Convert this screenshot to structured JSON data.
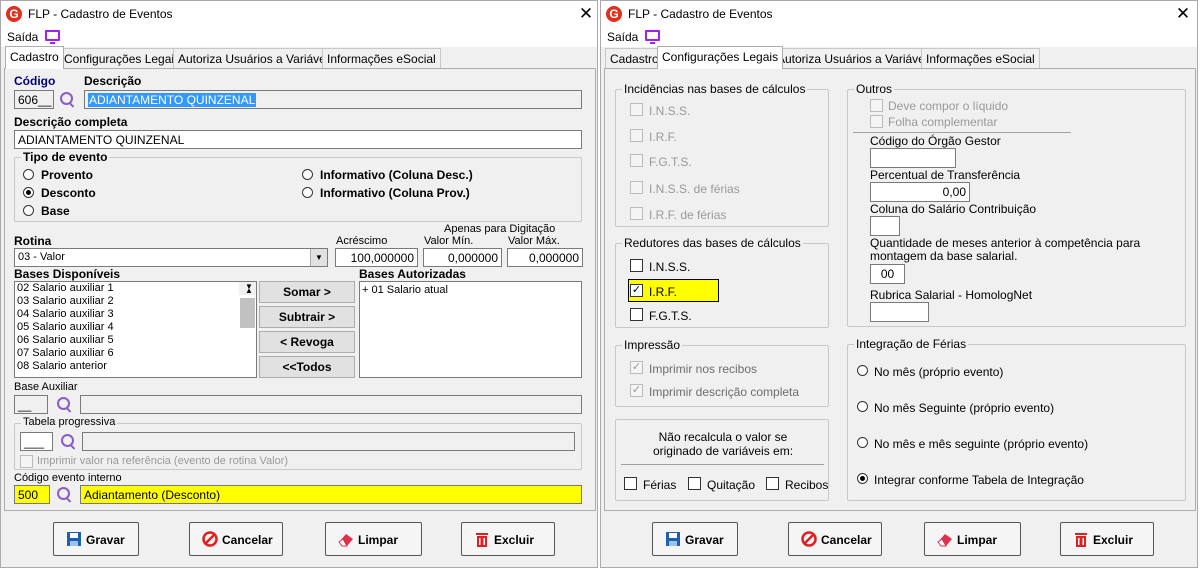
{
  "left": {
    "title": "FLP - Cadastro de Eventos",
    "menu": "Saída",
    "tabs": [
      "Cadastro",
      "Configurações Legais",
      "Autoriza Usuários a Variáveis",
      "Informações eSocial"
    ],
    "codigo_label": "Código",
    "codigo_value": "606__",
    "descricao_label": "Descrição",
    "descricao_value": "ADIANTAMENTO QUINZENAL",
    "desc_completa_label": "Descrição completa",
    "desc_completa_value": "ADIANTAMENTO QUINZENAL",
    "tipo_evento": {
      "title": "Tipo de evento",
      "proventos": "Provento",
      "desconto": "Desconto",
      "base": "Base",
      "info_desc": "Informativo (Coluna Desc.)",
      "info_prov": "Informativo (Coluna Prov.)"
    },
    "rotina_label": "Rotina",
    "rotina_value": "03 - Valor",
    "apenas_label": "Apenas para Digitação",
    "acrescimo_label": "Acréscimo",
    "acrescimo_value": "100,000000",
    "valor_min_label": "Valor Mín.",
    "valor_min_value": "0,000000",
    "valor_max_label": "Valor Máx.",
    "valor_max_value": "0,000000",
    "bases_disp_label": "Bases Disponíveis",
    "bases_disp": [
      "02 Salario auxiliar 1",
      "03 Salario auxiliar 2",
      "04 Salario auxiliar 3",
      "05 Salario auxiliar 4",
      "06 Salario auxiliar 5",
      "07 Salario auxiliar 6",
      "08 Salario anterior"
    ],
    "bases_aut_label": "Bases Autorizadas",
    "bases_aut": [
      "+ 01 Salario atual"
    ],
    "btn_somar": "Somar >",
    "btn_subtrair": "Subtrair >",
    "btn_revoga": "< Revoga",
    "btn_todos": "<<Todos",
    "base_aux_label": "Base Auxiliar",
    "base_aux_value": "__",
    "tabela_prog_label": "Tabela progressiva",
    "tabela_prog_value": "___",
    "imprimir_ref": "Imprimir valor na referência (evento de rotina Valor)",
    "cod_interno_label": "Código evento interno",
    "cod_interno_value": "500",
    "cod_interno_desc": "Adiantamento (Desconto)",
    "buttons": {
      "gravar": "Gravar",
      "cancelar": "Cancelar",
      "limpar": "Limpar",
      "excluir": "Excluir"
    }
  },
  "right": {
    "title": "FLP - Cadastro de Eventos",
    "menu": "Saída",
    "tabs": [
      "Cadastro",
      "Configurações Legais",
      "Autoriza Usuários a Variáveis",
      "Informações eSocial"
    ],
    "incidencias": {
      "title": "Incidências nas bases de cálculos",
      "items": [
        "I.N.S.S.",
        "I.R.F.",
        "F.G.T.S.",
        "I.N.S.S. de férias",
        "I.R.F. de férias"
      ]
    },
    "redutores": {
      "title": "Redutores das bases de cálculos",
      "items": [
        "I.N.S.S.",
        "I.R.F.",
        "F.G.T.S."
      ]
    },
    "impressao": {
      "title": "Impressão",
      "items": [
        "Imprimir nos recibos",
        "Imprimir descrição completa"
      ]
    },
    "nao_recalcula": "Não recalcula o valor se originado de variáveis em:",
    "nr_items": [
      "Férias",
      "Quitação",
      "Recibos"
    ],
    "outros": {
      "title": "Outros",
      "deve_compor": "Deve compor o líquido",
      "folha_comp": "Folha complementar",
      "cod_orgao": "Código do Órgão Gestor",
      "perc_transf": "Percentual de Transferência",
      "perc_transf_value": "0,00",
      "coluna_sal": "Coluna do Salário Contribuição",
      "qtd_meses": "Quantidade de meses anterior à competência para montagem da base salarial.",
      "qtd_meses_value": "00",
      "rubrica": "Rubrica Salarial - HomologNet"
    },
    "integracao": {
      "title": "Integração de Férias",
      "items": [
        "No mês (próprio evento)",
        "No mês Seguinte (próprio evento)",
        "No mês e mês seguinte (próprio evento)",
        "Integrar conforme Tabela de Integração"
      ]
    },
    "buttons": {
      "gravar": "Gravar",
      "cancelar": "Cancelar",
      "limpar": "Limpar",
      "excluir": "Excluir"
    }
  }
}
